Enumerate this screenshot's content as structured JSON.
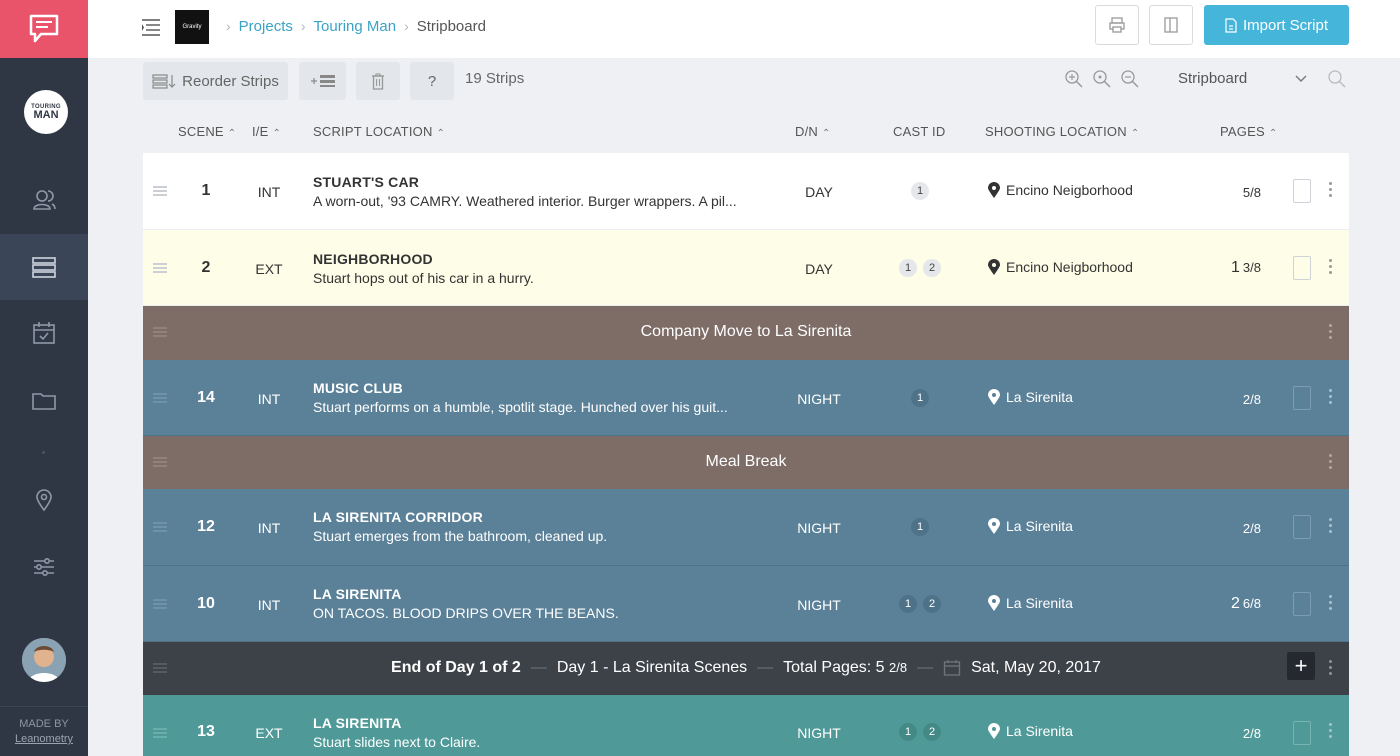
{
  "sidebar": {
    "project_logo_line1": "TOURING",
    "project_logo_line2": "MAN",
    "made_by": "MADE BY",
    "made_by_link": "Leanometry",
    "items": [
      "contacts-icon",
      "stripboard-icon",
      "calendar-icon",
      "folder-icon",
      "location-icon",
      "settings-icon"
    ]
  },
  "header": {
    "company_logo": "Gravity",
    "breadcrumb": [
      "Projects",
      "Touring Man",
      "Stripboard"
    ],
    "import_label": "Import Script"
  },
  "toolbar": {
    "reorder_label": "Reorder Strips",
    "help_label": "?",
    "strip_count": "19 Strips",
    "view_selected": "Stripboard"
  },
  "columns": {
    "scene": "SCENE",
    "ie": "I/E",
    "script_location": "SCRIPT LOCATION",
    "dn": "D/N",
    "cast_id": "CAST ID",
    "shooting_location": "SHOOTING LOCATION",
    "pages": "PAGES"
  },
  "strips": [
    {
      "scene": "1",
      "ie": "INT",
      "title": "STUART'S CAR",
      "desc": "A worn-out, '93 CAMRY. Weathered interior. Burger wrappers. A pil...",
      "dn": "DAY",
      "cast": [
        "1"
      ],
      "location": "Encino Neigborhood",
      "pages_whole": "",
      "pages_frac": "5/8",
      "color": "#ffffff"
    },
    {
      "scene": "2",
      "ie": "EXT",
      "title": "NEIGHBORHOOD",
      "desc": "Stuart hops out of his car in a hurry.",
      "dn": "DAY",
      "cast": [
        "1",
        "2"
      ],
      "location": "Encino Neigborhood",
      "pages_whole": "1",
      "pages_frac": "3/8",
      "color": "#fefde7"
    },
    {
      "banner": "Company Move to La Sirenita"
    },
    {
      "scene": "14",
      "ie": "INT",
      "title": "MUSIC CLUB",
      "desc": "Stuart performs on a humble, spotlit stage. Hunched over his guit...",
      "dn": "NIGHT",
      "cast": [
        "1"
      ],
      "location": "La Sirenita",
      "pages_whole": "",
      "pages_frac": "2/8",
      "color": "#5b8199"
    },
    {
      "banner": "Meal Break"
    },
    {
      "scene": "12",
      "ie": "INT",
      "title": "LA SIRENITA CORRIDOR",
      "desc": "Stuart emerges from the bathroom, cleaned up.",
      "dn": "NIGHT",
      "cast": [
        "1"
      ],
      "location": "La Sirenita",
      "pages_whole": "",
      "pages_frac": "2/8",
      "color": "#5b8199"
    },
    {
      "scene": "10",
      "ie": "INT",
      "title": "LA SIRENITA",
      "desc": "ON TACOS. BLOOD DRIPS OVER THE BEANS.",
      "dn": "NIGHT",
      "cast": [
        "1",
        "2"
      ],
      "location": "La Sirenita",
      "pages_whole": "2",
      "pages_frac": "6/8",
      "color": "#5b8199"
    },
    {
      "end_of_day": {
        "label": "End of Day 1 of 2",
        "name": "Day 1 - La Sirenita Scenes",
        "total_pages_label": "Total Pages: 5",
        "total_pages_frac": "2/8",
        "date": "Sat, May 20, 2017"
      }
    },
    {
      "scene": "13",
      "ie": "EXT",
      "title": "LA SIRENITA",
      "desc": "Stuart slides next to Claire.",
      "dn": "NIGHT",
      "cast": [
        "1",
        "2"
      ],
      "location": "La Sirenita",
      "pages_whole": "",
      "pages_frac": "2/8",
      "color": "#4f9a98"
    }
  ],
  "colors": {
    "brand": "#e9546b",
    "accent": "#45b5da",
    "sidebar": "#2f3744",
    "banner": "#7d6d66",
    "end_of_day": "#3d4249"
  }
}
